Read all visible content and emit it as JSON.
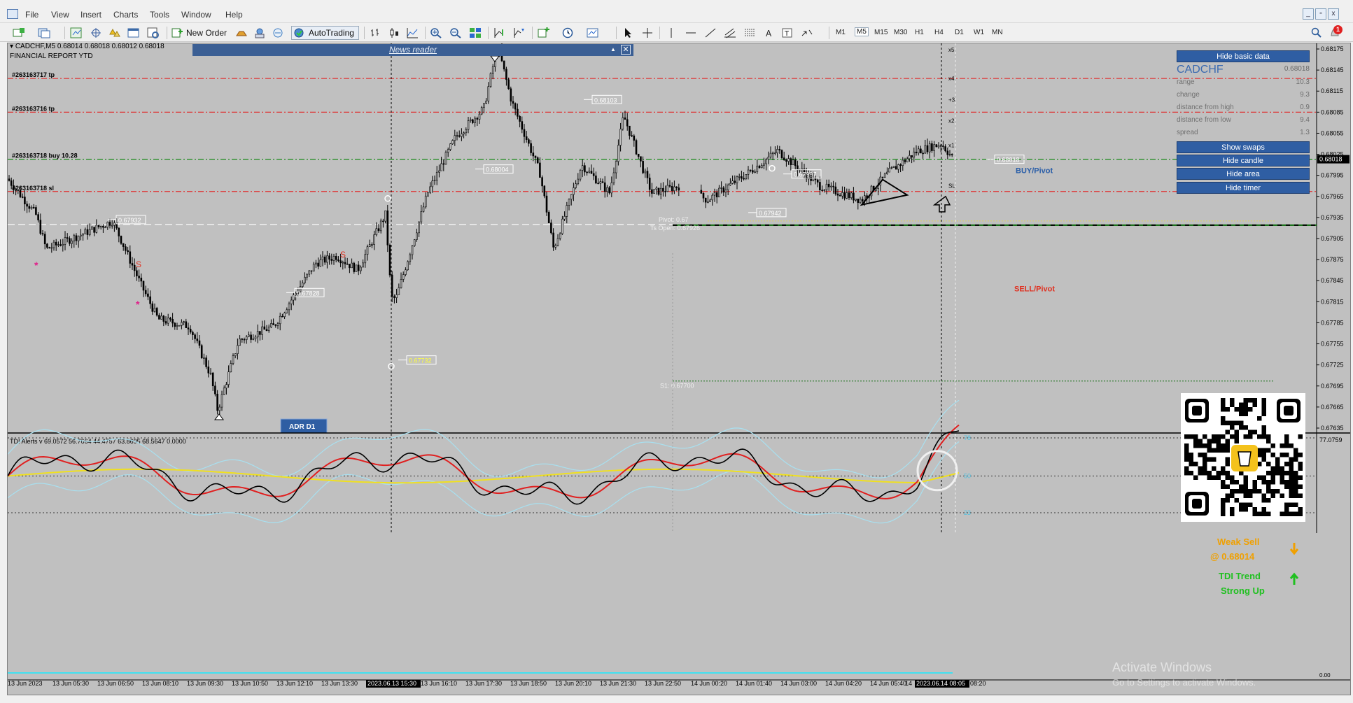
{
  "menu": {
    "items": [
      "File",
      "View",
      "Insert",
      "Charts",
      "Tools",
      "Window",
      "Help"
    ],
    "window_buttons": [
      "_",
      "▫",
      "x"
    ]
  },
  "toolbar": {
    "new_order_label": "New Order",
    "autotrading_label": "AutoTrading",
    "timeframes": [
      "M1",
      "M5",
      "M15",
      "M30",
      "H1",
      "H4",
      "D1",
      "W1",
      "MN"
    ],
    "active_timeframe": "M5",
    "alert_count": "1"
  },
  "chart": {
    "symbol_line": "CADCHF,M5  0.68014 0.68018 0.68012 0.68018",
    "report_label": "FINANCIAL REPORT YTD",
    "news_reader_label": "News reader",
    "news_close": "✕",
    "news_up": "▲",
    "order_lines": [
      {
        "label": "#263163717 tp",
        "price": 0.68133,
        "color": "#e03030"
      },
      {
        "label": "#263163716 tp",
        "price": 0.68085,
        "color": "#e03030"
      },
      {
        "label": "#263163718 buy 10.28",
        "price": 0.68018,
        "color": "#1a8a1a"
      },
      {
        "label": "#263163718 sl",
        "price": 0.67972,
        "color": "#e03030"
      }
    ],
    "price_axis": [
      "0.68175",
      "0.68145",
      "0.68115",
      "0.68085",
      "0.68055",
      "0.68025",
      "0.67995",
      "0.67965",
      "0.67935",
      "0.67905",
      "0.67875",
      "0.67845",
      "0.67815",
      "0.67785",
      "0.67755",
      "0.67725",
      "0.67695",
      "0.67665",
      "0.67635"
    ],
    "current_price": "0.68018",
    "time_axis": [
      "13 Jun 2023",
      "13 Jun 05:30",
      "13 Jun 06:50",
      "13 Jun 08:10",
      "13 Jun 09:30",
      "13 Jun 10:50",
      "13 Jun 12:10",
      "13 Jun 13:30",
      "2023.06.13 15:30",
      "13 Jun 16:10",
      "13 Jun 17:30",
      "13 Jun 18:50",
      "13 Jun 20:10",
      "13 Jun 21:30",
      "13 Jun 22:50",
      "14 Jun 00:20",
      "14 Jun 01:40",
      "14 Jun 03:00",
      "14 Jun 04:20",
      "14 Jun 05:40",
      "14",
      "2023.06.14 08:05",
      "08:20"
    ],
    "highlighted_time_1": "2023.06.13 15:30",
    "highlighted_time_2": "2023.06.14 08:05",
    "price_labels": [
      "0.67932",
      "0.67828",
      "0.67732",
      "0.68004",
      "0.68103",
      "0.67942",
      "0.67997",
      "0.68018"
    ],
    "pivot_text": "Pivot: 0.67",
    "ts_open_text": "Ts Open: 0.67926",
    "s1_text": "S1: 0.67700",
    "buy_pivot": "BUY/Pivot",
    "sell_pivot": "SELL/Pivot",
    "adr_label": "ADR D1",
    "x_markers": [
      "x5",
      "x4",
      "+3",
      "x2",
      "x1",
      "SL"
    ],
    "signal_s": "S"
  },
  "panel": {
    "hide_basic": "Hide basic data",
    "symbol": "CADCHF",
    "price": "0.68018",
    "rows": [
      {
        "label": "range",
        "value": "10.3"
      },
      {
        "label": "change",
        "value": "9.3"
      },
      {
        "label": "distance from high",
        "value": "0.9"
      },
      {
        "label": "distance from low",
        "value": "9.4"
      },
      {
        "label": "spread",
        "value": "1.3"
      }
    ],
    "buttons": [
      "Show swaps",
      "Hide candle",
      "Hide area",
      "Hide timer"
    ]
  },
  "indicator": {
    "title": "TDI Alerts v 69.0572 56.7664 44.4757 63.8695 68.5647 0.0000",
    "levels": [
      "78",
      "50",
      "23"
    ],
    "axis_top": "77.0759",
    "axis_bottom": "0.00",
    "weak_sell": "Weak Sell",
    "weak_sell_price": "@ 0.68014",
    "trend_1": "TDI Trend",
    "trend_2": "Strong Up",
    "sell_color": "#f0a000",
    "up_color": "#20c020"
  },
  "watermark": {
    "line1": "Activate Windows",
    "line2": "Go to Settings to activate Windows."
  }
}
